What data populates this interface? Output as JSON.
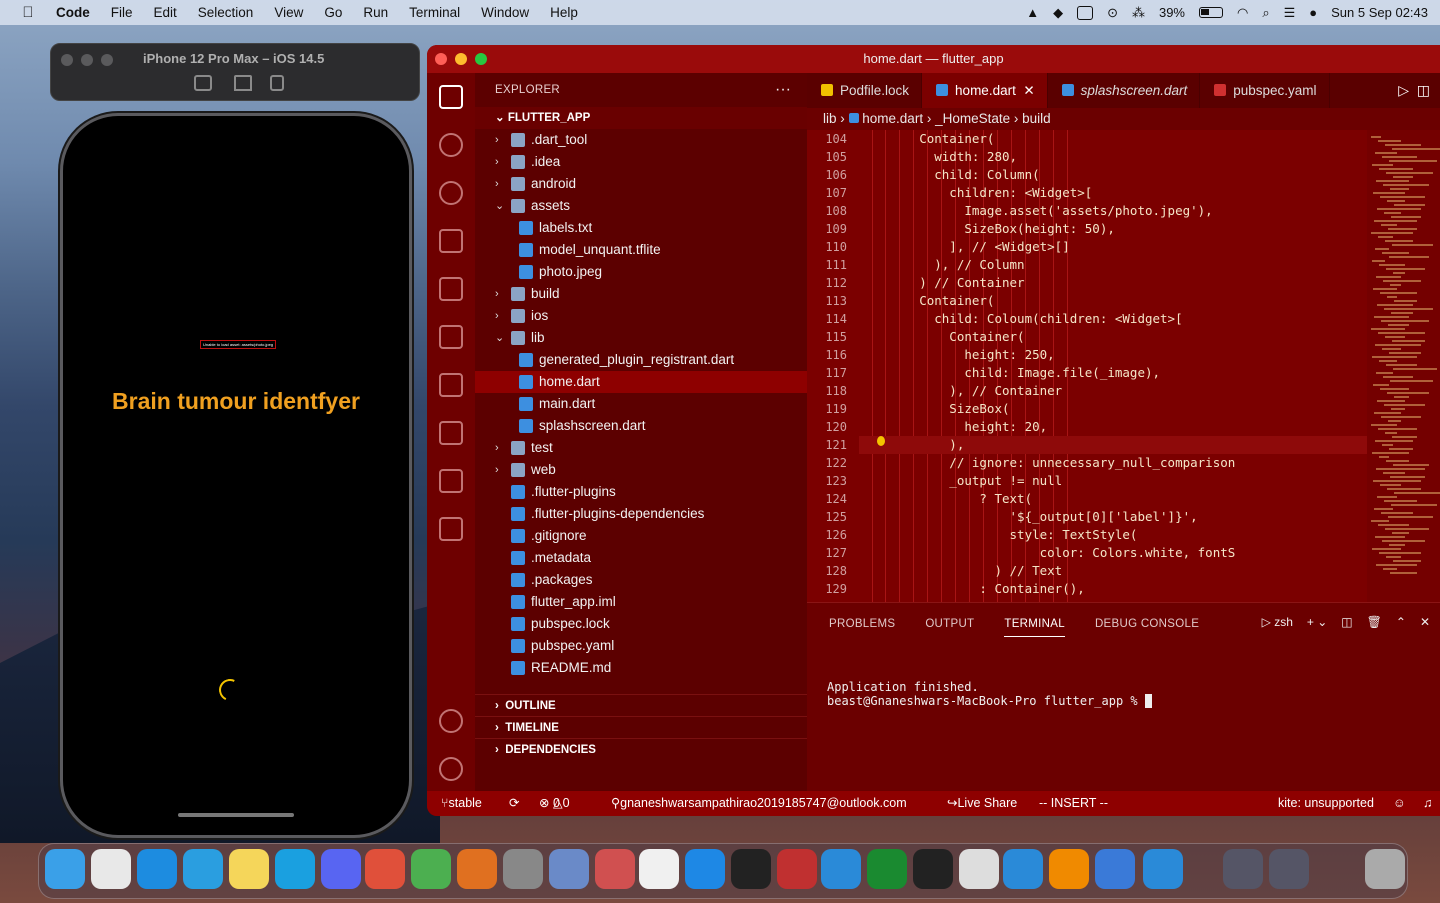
{
  "menubar": {
    "app": "Code",
    "items": [
      "File",
      "Edit",
      "Selection",
      "View",
      "Go",
      "Run",
      "Terminal",
      "Window",
      "Help"
    ],
    "battery": "39%",
    "datetime": "Sun 5 Sep  02:43"
  },
  "simulator": {
    "title": "iPhone 12 Pro Max – iOS 14.5",
    "error_text": "Unable to load asset: assets/photo.jpeg",
    "app_title": "Brain tumour identfyer"
  },
  "vscode": {
    "window_title": "home.dart — flutter_app",
    "explorer": {
      "header": "EXPLORER",
      "project": "FLUTTER_APP",
      "tree": [
        ".dart_tool",
        ".idea",
        "android",
        "assets",
        "labels.txt",
        "model_unquant.tflite",
        "photo.jpeg",
        "build",
        "ios",
        "lib",
        "generated_plugin_registrant.dart",
        "home.dart",
        "main.dart",
        "splashscreen.dart",
        "test",
        "web",
        ".flutter-plugins",
        ".flutter-plugins-dependencies",
        ".gitignore",
        ".metadata",
        ".packages",
        "flutter_app.iml",
        "pubspec.lock",
        "pubspec.yaml",
        "README.md"
      ],
      "sections": [
        "OUTLINE",
        "TIMELINE",
        "DEPENDENCIES"
      ]
    },
    "tabs": [
      "Podfile.lock",
      "home.dart",
      "splashscreen.dart",
      "pubspec.yaml"
    ],
    "breadcrumb": {
      "a": "lib",
      "b": "home.dart",
      "c": "_HomeState",
      "d": "build"
    },
    "lines": [
      {
        "n": "104",
        "t": "        Container("
      },
      {
        "n": "105",
        "t": "          width: 280,"
      },
      {
        "n": "106",
        "t": "          child: Column("
      },
      {
        "n": "107",
        "t": "            children: <Widget>["
      },
      {
        "n": "108",
        "t": "              Image.asset('assets/photo.jpeg'),"
      },
      {
        "n": "109",
        "t": "              SizeBox(height: 50),"
      },
      {
        "n": "110",
        "t": "            ], // <Widget>[]"
      },
      {
        "n": "111",
        "t": "          ), // Column"
      },
      {
        "n": "112",
        "t": "        ) // Container"
      },
      {
        "n": "113",
        "t": "        Container("
      },
      {
        "n": "114",
        "t": "          child: Coloum(children: <Widget>["
      },
      {
        "n": "115",
        "t": "            Container("
      },
      {
        "n": "116",
        "t": "              height: 250,"
      },
      {
        "n": "117",
        "t": "              child: Image.file(_image),"
      },
      {
        "n": "118",
        "t": "            ), // Container"
      },
      {
        "n": "119",
        "t": "            SizeBox("
      },
      {
        "n": "120",
        "t": "              height: 20,"
      },
      {
        "n": "121",
        "t": "            ),"
      },
      {
        "n": "122",
        "t": "            // ignore: unnecessary_null_comparison"
      },
      {
        "n": "123",
        "t": "            _output != null"
      },
      {
        "n": "124",
        "t": "                ? Text("
      },
      {
        "n": "125",
        "t": "                    '${_output[0]['label']}',"
      },
      {
        "n": "126",
        "t": "                    style: TextStyle("
      },
      {
        "n": "127",
        "t": "                        color: Colors.white, fontS"
      },
      {
        "n": "128",
        "t": "                  ) // Text"
      },
      {
        "n": "129",
        "t": "                : Container(),"
      }
    ],
    "panel": {
      "tabs": [
        "PROBLEMS",
        "OUTPUT",
        "TERMINAL",
        "DEBUG CONSOLE"
      ],
      "shell": "zsh",
      "line1": "Application finished.",
      "line2": "beast@Gnaneshwars-MacBook-Pro flutter_app % "
    },
    "status": {
      "branch": "stable",
      "errors": "0",
      "warnings": "0",
      "account": "gnaneshwarsampathirao2019185747@outlook.com",
      "liveshare": "Live Share",
      "mode": "-- INSERT --",
      "kite": "kite: unsupported"
    }
  }
}
